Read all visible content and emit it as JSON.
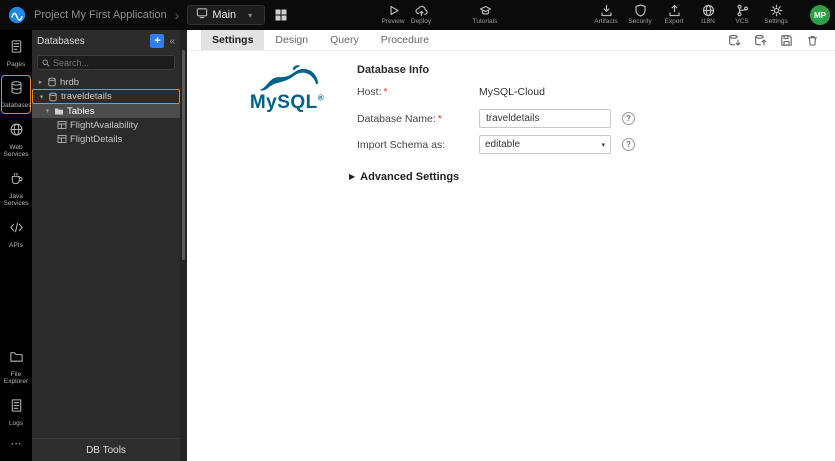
{
  "glyphs": {
    "chevron_right": "›",
    "caret_down": "▾",
    "caret_right": "▸",
    "collapse": "«",
    "plus": "+",
    "ellipsis": "⋯",
    "advanced_caret": "▶",
    "select_caret": "▾",
    "help": "?",
    "required": "*",
    "registered": "®"
  },
  "topbar": {
    "project_label": "Project My First Application",
    "page_selector_label": "Main",
    "preview_label": "Preview",
    "deploy_label": "Deploy",
    "tutorials_label": "Tutorials",
    "right_icons": [
      {
        "icon": "artifacts-icon",
        "label": "Artifacts"
      },
      {
        "icon": "security-icon",
        "label": "Security"
      },
      {
        "icon": "export-icon",
        "label": "Export"
      },
      {
        "icon": "i18n-icon",
        "label": "I18N"
      },
      {
        "icon": "vcs-icon",
        "label": "VCS"
      },
      {
        "icon": "settings-icon",
        "label": "Settings"
      }
    ],
    "avatar_initials": "MP"
  },
  "sidebar": {
    "items": [
      {
        "icon": "pages-icon",
        "label": "Pages",
        "active": false
      },
      {
        "icon": "database-icon",
        "label": "Databases",
        "active": true
      },
      {
        "icon": "web-services-icon",
        "label": "Web Services",
        "active": false
      },
      {
        "icon": "java-services-icon",
        "label": "Java Services",
        "active": false
      },
      {
        "icon": "apis-icon",
        "label": "APIs",
        "active": false
      }
    ],
    "bottom_items": [
      {
        "icon": "file-explorer-icon",
        "label": "File Explorer"
      },
      {
        "icon": "logs-icon",
        "label": "Logs"
      }
    ]
  },
  "panel": {
    "title": "Databases",
    "search_placeholder": "Search...",
    "tree": [
      {
        "label": "hrdb",
        "caret": "▸",
        "type": "database",
        "depth": 1,
        "state": ""
      },
      {
        "label": "traveldetails",
        "caret": "▾",
        "type": "database",
        "depth": 1,
        "state": "highlighted"
      },
      {
        "label": "Tables",
        "caret": "▾",
        "type": "folder",
        "depth": 2,
        "state": "selected"
      },
      {
        "label": "FlightAvailability",
        "caret": "",
        "type": "table",
        "depth": 3,
        "state": ""
      },
      {
        "label": "FlightDetails",
        "caret": "",
        "type": "table",
        "depth": 3,
        "state": ""
      }
    ],
    "db_tools_label": "DB Tools"
  },
  "main": {
    "tabs": [
      "Settings",
      "Design",
      "Query",
      "Procedure"
    ],
    "active_tab": "Settings",
    "tab_action_icons": [
      "db-import-icon",
      "db-export-icon",
      "save-icon",
      "delete-icon"
    ],
    "logo_text": "MySQL",
    "section_title": "Database Info",
    "host_label": "Host:",
    "host_value": "MySQL-Cloud",
    "db_name_label": "Database Name:",
    "db_name_value": "traveldetails",
    "import_label": "Import Schema as:",
    "import_value": "editable",
    "advanced_label": "Advanced Settings"
  },
  "colors": {
    "highlight_orange": "#ef8220",
    "add_button_blue": "#2d7ff0",
    "mysql_blue": "#00618a",
    "avatar_green": "#2f9e44"
  }
}
